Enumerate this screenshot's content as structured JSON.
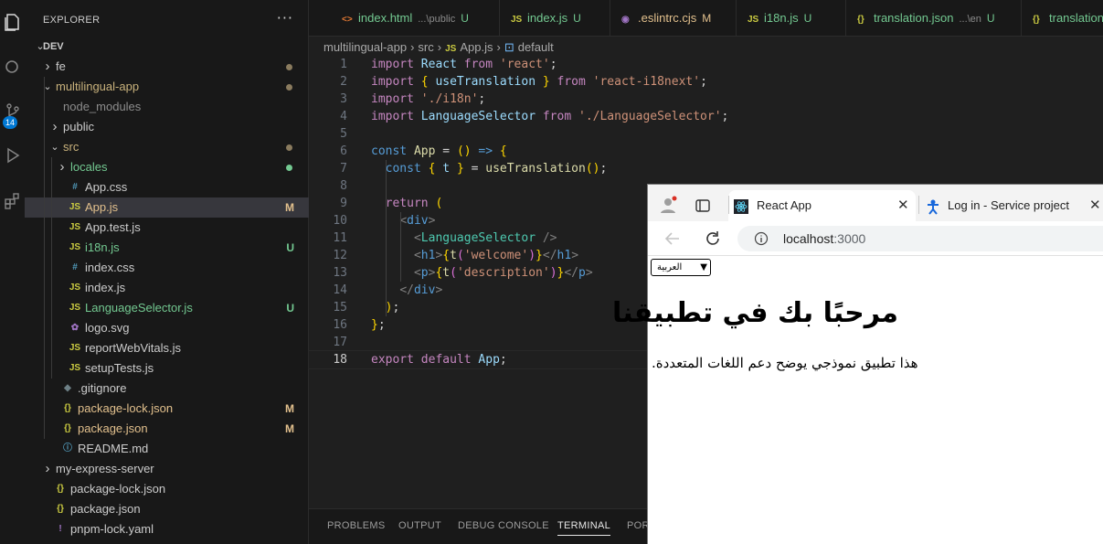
{
  "activity": {
    "scm_badge": "14"
  },
  "explorer": {
    "title": "EXPLORER",
    "more": "···",
    "rows": [
      {
        "label": "DEV",
        "depth": 0,
        "kind": "root",
        "open": true
      },
      {
        "label": "fe",
        "depth": 1,
        "kind": "folder",
        "open": false,
        "dot": "#8a7b5e"
      },
      {
        "label": "multilingual-app",
        "depth": 1,
        "kind": "folder",
        "open": true,
        "dot": "#8a7b5e",
        "color": "#c9b27c"
      },
      {
        "label": "node_modules",
        "depth": 2,
        "kind": "folder-plain",
        "color": "#8c8c8c"
      },
      {
        "label": "public",
        "depth": 2,
        "kind": "folder",
        "open": false
      },
      {
        "label": "src",
        "depth": 2,
        "kind": "folder",
        "open": true,
        "dot": "#8a7b5e",
        "color": "#c9b27c"
      },
      {
        "label": "locales",
        "depth": 3,
        "kind": "folder",
        "open": false,
        "dot": "#73c991",
        "color": "#73c991"
      },
      {
        "label": "App.css",
        "depth": 3,
        "kind": "file",
        "icon": "#",
        "iconColor": "#519aba"
      },
      {
        "label": "App.js",
        "depth": 3,
        "kind": "file",
        "icon": "JS",
        "iconColor": "#cbcb41",
        "status": "M",
        "statusColor": "#e2c08d",
        "color": "#e2c08d",
        "selected": true
      },
      {
        "label": "App.test.js",
        "depth": 3,
        "kind": "file",
        "icon": "JS",
        "iconColor": "#cbcb41"
      },
      {
        "label": "i18n.js",
        "depth": 3,
        "kind": "file",
        "icon": "JS",
        "iconColor": "#cbcb41",
        "status": "U",
        "statusColor": "#73c991",
        "color": "#73c991"
      },
      {
        "label": "index.css",
        "depth": 3,
        "kind": "file",
        "icon": "#",
        "iconColor": "#519aba"
      },
      {
        "label": "index.js",
        "depth": 3,
        "kind": "file",
        "icon": "JS",
        "iconColor": "#cbcb41"
      },
      {
        "label": "LanguageSelector.js",
        "depth": 3,
        "kind": "file",
        "icon": "JS",
        "iconColor": "#cbcb41",
        "status": "U",
        "statusColor": "#73c991",
        "color": "#73c991"
      },
      {
        "label": "logo.svg",
        "depth": 3,
        "kind": "file",
        "icon": "✿",
        "iconColor": "#a074c4"
      },
      {
        "label": "reportWebVitals.js",
        "depth": 3,
        "kind": "file",
        "icon": "JS",
        "iconColor": "#cbcb41"
      },
      {
        "label": "setupTests.js",
        "depth": 3,
        "kind": "file",
        "icon": "JS",
        "iconColor": "#cbcb41"
      },
      {
        "label": ".gitignore",
        "depth": 2,
        "kind": "file",
        "icon": "◆",
        "iconColor": "#6d8086"
      },
      {
        "label": "package-lock.json",
        "depth": 2,
        "kind": "file",
        "icon": "{}",
        "iconColor": "#cbcb41",
        "status": "M",
        "statusColor": "#e2c08d",
        "color": "#e2c08d"
      },
      {
        "label": "package.json",
        "depth": 2,
        "kind": "file",
        "icon": "{}",
        "iconColor": "#cbcb41",
        "status": "M",
        "statusColor": "#e2c08d",
        "color": "#e2c08d"
      },
      {
        "label": "README.md",
        "depth": 2,
        "kind": "file",
        "icon": "ⓘ",
        "iconColor": "#519aba"
      },
      {
        "label": "my-express-server",
        "depth": 1,
        "kind": "folder",
        "open": false
      },
      {
        "label": "package-lock.json",
        "depth": 1,
        "kind": "file",
        "icon": "{}",
        "iconColor": "#cbcb41"
      },
      {
        "label": "package.json",
        "depth": 1,
        "kind": "file",
        "icon": "{}",
        "iconColor": "#cbcb41"
      },
      {
        "label": "pnpm-lock.yaml",
        "depth": 1,
        "kind": "file",
        "icon": "!",
        "iconColor": "#a074c4"
      }
    ]
  },
  "tabs": [
    {
      "label": "index.html",
      "desc": "...\\public",
      "status": "U",
      "icon": "<>",
      "iconColor": "#e37933",
      "color": "#73c991",
      "statusColor": "#73c991"
    },
    {
      "label": "index.js",
      "desc": "",
      "status": "U",
      "icon": "JS",
      "iconColor": "#cbcb41",
      "color": "#73c991",
      "statusColor": "#73c991"
    },
    {
      "label": ".eslintrc.cjs",
      "desc": "",
      "status": "M",
      "icon": "◉",
      "iconColor": "#a074c4",
      "color": "#e2c08d",
      "statusColor": "#e2c08d"
    },
    {
      "label": "i18n.js",
      "desc": "",
      "status": "U",
      "icon": "JS",
      "iconColor": "#cbcb41",
      "color": "#73c991",
      "statusColor": "#73c991"
    },
    {
      "label": "translation.json",
      "desc": "...\\en",
      "status": "U",
      "icon": "{}",
      "iconColor": "#cbcb41",
      "color": "#73c991",
      "statusColor": "#73c991"
    },
    {
      "label": "translation",
      "desc": "",
      "status": "",
      "icon": "{}",
      "iconColor": "#cbcb41",
      "color": "#73c991",
      "statusColor": "#73c991"
    }
  ],
  "breadcrumb": [
    "multilingual-app",
    "src",
    "App.js",
    "default"
  ],
  "code": [
    "import React from 'react';",
    "import { useTranslation } from 'react-i18next';",
    "import './i18n';",
    "import LanguageSelector from './LanguageSelector';",
    "",
    "const App = () => {",
    "  const { t } = useTranslation();",
    "",
    "  return (",
    "    <div>",
    "      <LanguageSelector />",
    "      <h1>{t('welcome')}</h1>",
    "      <p>{t('description')}</p>",
    "    </div>",
    "  );",
    "};",
    "",
    "export default App;"
  ],
  "panel_tabs": [
    "PROBLEMS",
    "OUTPUT",
    "DEBUG CONSOLE",
    "TERMINAL",
    "POR"
  ],
  "browser": {
    "tabs": [
      {
        "label": "React App"
      },
      {
        "label": "Log in - Service project"
      }
    ],
    "url_host": "localhost",
    "url_port": ":3000",
    "page": {
      "select_value": "العربية",
      "heading": "مرحبًا بك في تطبيقنا",
      "paragraph": "هذا تطبيق نموذجي يوضح دعم اللغات المتعددة."
    }
  },
  "colors": {
    "accent": "#0078d4",
    "modified": "#e2c08d",
    "untracked": "#73c991"
  }
}
